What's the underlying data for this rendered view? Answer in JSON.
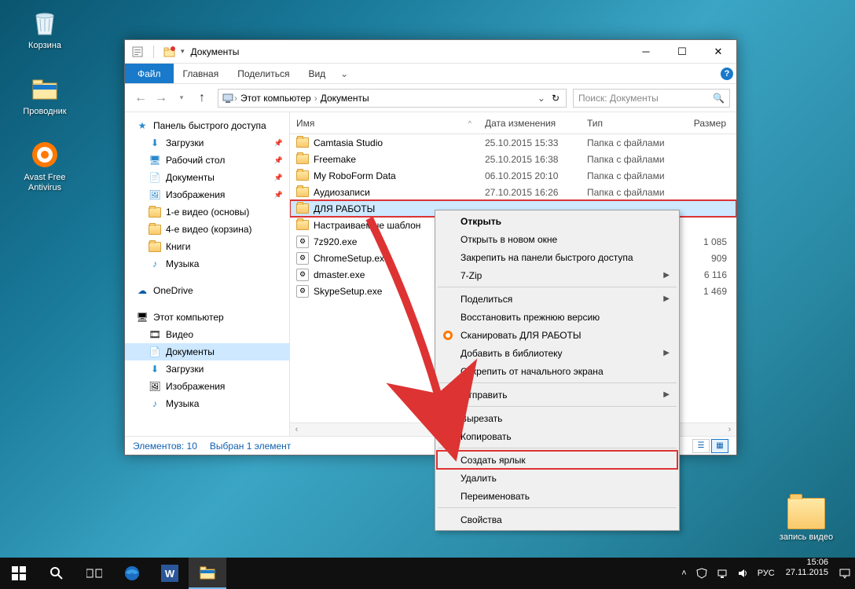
{
  "desktop": {
    "icons": [
      {
        "name": "recycle-bin",
        "label": "Корзина"
      },
      {
        "name": "explorer",
        "label": "Проводник"
      },
      {
        "name": "avast",
        "label": "Avast Free Antivirus"
      }
    ],
    "right_folder": "запись видео"
  },
  "window": {
    "title": "Документы",
    "ribbon": {
      "file": "Файл",
      "tabs": [
        "Главная",
        "Поделиться",
        "Вид"
      ]
    },
    "breadcrumbs": [
      "Этот компьютер",
      "Документы"
    ],
    "search_placeholder": "Поиск: Документы",
    "refresh_tooltip": "Обновить",
    "columns": {
      "name": "Имя",
      "date": "Дата изменения",
      "type": "Тип",
      "size": "Размер"
    },
    "files": [
      {
        "icon": "folder",
        "name": "Camtasia Studio",
        "date": "25.10.2015 15:33",
        "type": "Папка с файлами",
        "size": ""
      },
      {
        "icon": "folder",
        "name": "Freemake",
        "date": "25.10.2015 16:38",
        "type": "Папка с файлами",
        "size": ""
      },
      {
        "icon": "folder",
        "name": "My RoboForm Data",
        "date": "06.10.2015 20:10",
        "type": "Папка с файлами",
        "size": ""
      },
      {
        "icon": "folder",
        "name": "Аудиозаписи",
        "date": "27.10.2015 16:26",
        "type": "Папка с файлами",
        "size": ""
      },
      {
        "icon": "folder",
        "name": "ДЛЯ РАБОТЫ",
        "date": "",
        "type": "",
        "size": "",
        "selected": true,
        "highlighted": true
      },
      {
        "icon": "folder",
        "name": "Настраиваемые шаблон",
        "date": "",
        "type": "",
        "size": ""
      },
      {
        "icon": "exe",
        "name": "7z920.exe",
        "date": "",
        "type": "",
        "size": "1 085"
      },
      {
        "icon": "exe",
        "name": "ChromeSetup.exe",
        "date": "",
        "type": "",
        "size": "909"
      },
      {
        "icon": "exe",
        "name": "dmaster.exe",
        "date": "",
        "type": "",
        "size": "6 116"
      },
      {
        "icon": "exe",
        "name": "SkypeSetup.exe",
        "date": "",
        "type": "",
        "size": "1 469"
      }
    ],
    "tree": {
      "quick": {
        "label": "Панель быстрого доступа",
        "items": [
          "Загрузки",
          "Рабочий стол",
          "Документы",
          "Изображения",
          "1-е видео (основы)",
          "4-е видео (корзина)",
          "Книги",
          "Музыка"
        ]
      },
      "onedrive": "OneDrive",
      "thispc": {
        "label": "Этот компьютер",
        "items": [
          "Видео",
          "Документы",
          "Загрузки",
          "Изображения",
          "Музыка"
        ],
        "selected": "Документы"
      }
    },
    "status": {
      "count": "Элементов: 10",
      "selected": "Выбран 1 элемент"
    }
  },
  "context_menu": [
    {
      "label": "Открыть",
      "bold": true
    },
    {
      "label": "Открыть в новом окне"
    },
    {
      "label": "Закрепить на панели быстрого доступа"
    },
    {
      "label": "7-Zip",
      "submenu": true
    },
    {
      "sep": true
    },
    {
      "label": "Поделиться",
      "submenu": true
    },
    {
      "label": "Восстановить прежнюю версию"
    },
    {
      "label": "Сканировать ДЛЯ РАБОТЫ",
      "icon": "avast"
    },
    {
      "label": "Добавить в библиотеку",
      "submenu": true
    },
    {
      "label": "Открепить от начального экрана"
    },
    {
      "sep": true
    },
    {
      "label": "Отправить",
      "submenu": true
    },
    {
      "sep": true
    },
    {
      "label": "Вырезать"
    },
    {
      "label": "Копировать"
    },
    {
      "sep": true
    },
    {
      "label": "Создать ярлык",
      "highlighted": true
    },
    {
      "label": "Удалить"
    },
    {
      "label": "Переименовать"
    },
    {
      "sep": true
    },
    {
      "label": "Свойства"
    }
  ],
  "taskbar": {
    "tray": {
      "lang": "РУС",
      "time": "15:06",
      "date": "27.11.2015"
    }
  }
}
